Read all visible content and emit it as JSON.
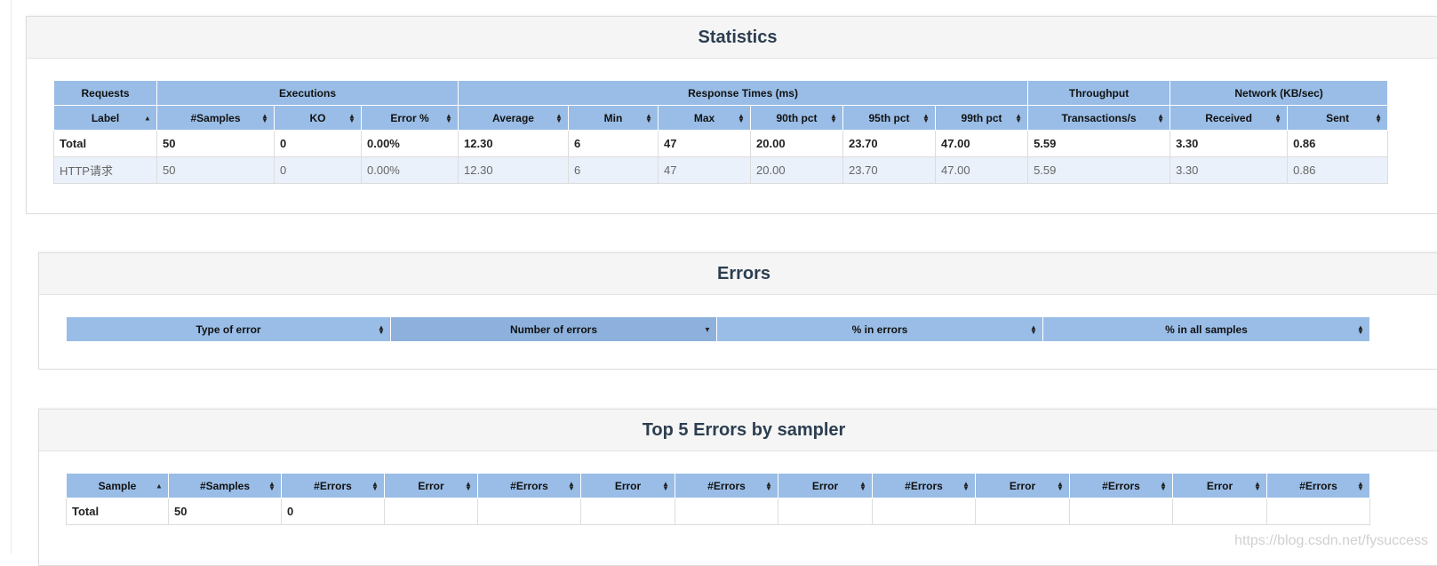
{
  "statistics": {
    "title": "Statistics",
    "groups": [
      "Requests",
      "Executions",
      "Response Times (ms)",
      "Throughput",
      "Network (KB/sec)"
    ],
    "columns": [
      "Label",
      "#Samples",
      "KO",
      "Error %",
      "Average",
      "Min",
      "Max",
      "90th pct",
      "95th pct",
      "99th pct",
      "Transactions/s",
      "Received",
      "Sent"
    ],
    "total": [
      "Total",
      "50",
      "0",
      "0.00%",
      "12.30",
      "6",
      "47",
      "20.00",
      "23.70",
      "47.00",
      "5.59",
      "3.30",
      "0.86"
    ],
    "rows": [
      [
        "HTTP请求",
        "50",
        "0",
        "0.00%",
        "12.30",
        "6",
        "47",
        "20.00",
        "23.70",
        "47.00",
        "5.59",
        "3.30",
        "0.86"
      ]
    ]
  },
  "errors": {
    "title": "Errors",
    "columns": [
      "Type of error",
      "Number of errors",
      "% in errors",
      "% in all samples"
    ]
  },
  "top5": {
    "title": "Top 5 Errors by sampler",
    "columns": [
      "Sample",
      "#Samples",
      "#Errors",
      "Error",
      "#Errors",
      "Error",
      "#Errors",
      "Error",
      "#Errors",
      "Error",
      "#Errors",
      "Error",
      "#Errors"
    ],
    "total": [
      "Total",
      "50",
      "0",
      "",
      "",
      "",
      "",
      "",
      "",
      "",
      "",
      "",
      ""
    ]
  },
  "watermark": "https://blog.csdn.net/fysuccess"
}
